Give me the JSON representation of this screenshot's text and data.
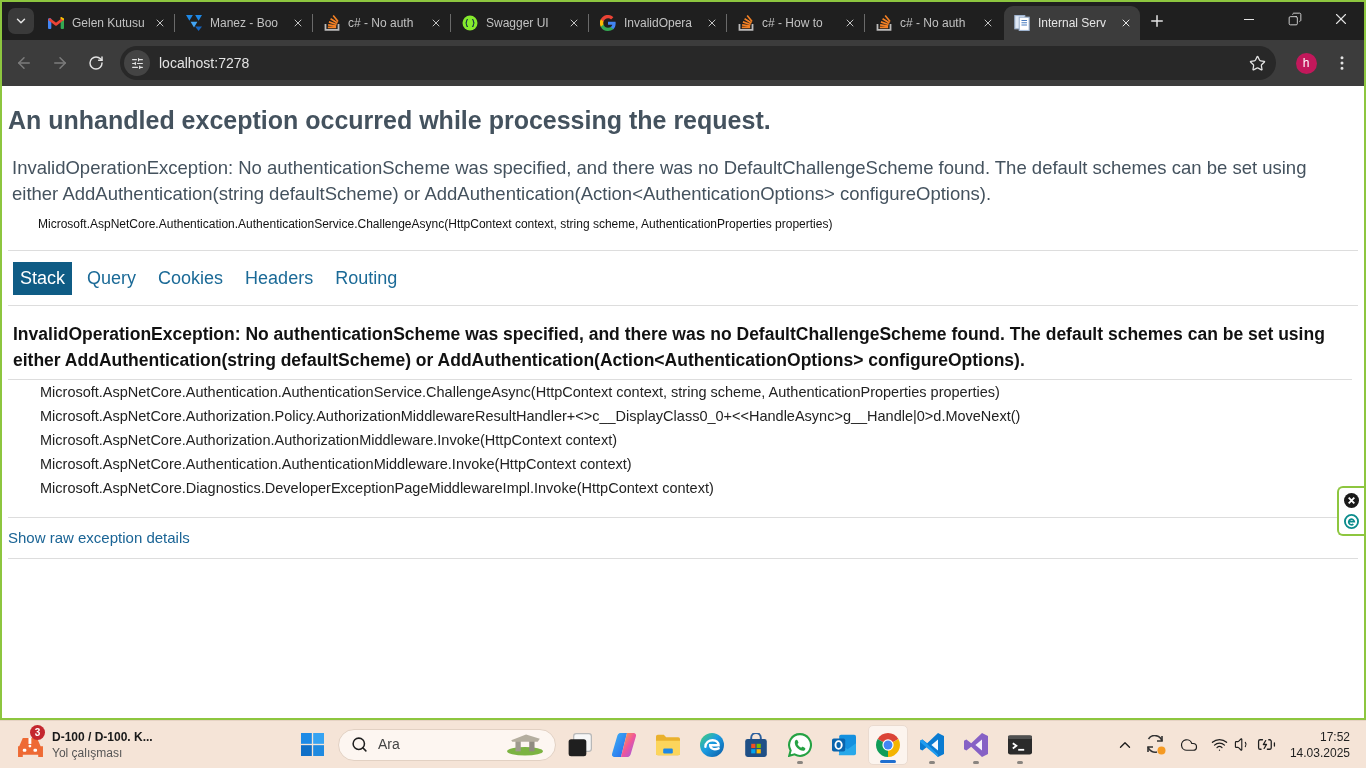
{
  "browser": {
    "tabs": [
      {
        "kind": "mail",
        "title": "Gelen Kutusu",
        "selected": false
      },
      {
        "kind": "tiles",
        "title": "Manez - Boo",
        "selected": false
      },
      {
        "kind": "stack",
        "title": "c# - No auth",
        "selected": false
      },
      {
        "kind": "braces",
        "title": "Swagger UI",
        "selected": false
      },
      {
        "kind": "google",
        "title": "InvalidOpera",
        "selected": false
      },
      {
        "kind": "stack",
        "title": "c# - How to",
        "selected": false
      },
      {
        "kind": "stack",
        "title": "c# - No auth",
        "selected": false
      },
      {
        "kind": "document",
        "title": "Internal Serv",
        "selected": true
      }
    ],
    "back": {
      "disabled": true
    },
    "forward": {
      "disabled": true
    },
    "address": "localhost:7278",
    "profile_initial": "h"
  },
  "page": {
    "heading": "An unhandled exception occurred while processing the request.",
    "error": {
      "message": "InvalidOperationException: No authenticationScheme was specified, and there was no DefaultChallengeScheme found. The default schemes can be set using either AddAuthentication(string defaultScheme) or AddAuthentication(Action<AuthenticationOptions> configureOptions).",
      "location": "Microsoft.AspNetCore.Authentication.AuthenticationService.ChallengeAsync(HttpContext context, string scheme, AuthenticationProperties properties)"
    },
    "tabs": [
      {
        "label": "Stack",
        "selected": true
      },
      {
        "label": "Query",
        "selected": false
      },
      {
        "label": "Cookies",
        "selected": false
      },
      {
        "label": "Headers",
        "selected": false
      },
      {
        "label": "Routing",
        "selected": false
      }
    ],
    "stack": {
      "title": "InvalidOperationException: No authenticationScheme was specified, and there was no DefaultChallengeScheme found. The default schemes can be set using either AddAuthentication(string defaultScheme) or AddAuthentication(Action<AuthenticationOptions> configureOptions).",
      "frames": [
        "Microsoft.AspNetCore.Authentication.AuthenticationService.ChallengeAsync(HttpContext context, string scheme, AuthenticationProperties properties)",
        "Microsoft.AspNetCore.Authorization.Policy.AuthorizationMiddlewareResultHandler+<>c__DisplayClass0_0+<<HandleAsync>g__Handle|0>d.MoveNext()",
        "Microsoft.AspNetCore.Authorization.AuthorizationMiddleware.Invoke(HttpContext context)",
        "Microsoft.AspNetCore.Authentication.AuthenticationMiddleware.Invoke(HttpContext context)",
        "Microsoft.AspNetCore.Diagnostics.DeveloperExceptionPageMiddlewareImpl.Invoke(HttpContext context)"
      ]
    },
    "raw_link": "Show raw exception details"
  },
  "taskbar": {
    "alert": {
      "badge": "3",
      "title": "D-100 / D-100. K...",
      "subtitle": "Yol çalışması"
    },
    "search": {
      "placeholder": "Ara"
    },
    "apps": [
      {
        "kind": "taskview",
        "running": false,
        "selected": false
      },
      {
        "kind": "copilot",
        "running": false,
        "selected": false
      },
      {
        "kind": "folder",
        "running": false,
        "selected": false
      },
      {
        "kind": "edge",
        "running": false,
        "selected": false
      },
      {
        "kind": "store",
        "running": false,
        "selected": false
      },
      {
        "kind": "whatsapp",
        "running": true,
        "selected": false
      },
      {
        "kind": "outlook",
        "running": false,
        "selected": false
      },
      {
        "kind": "chrome",
        "running": true,
        "selected": true
      },
      {
        "kind": "vscode",
        "running": true,
        "selected": false
      },
      {
        "kind": "studio",
        "running": true,
        "selected": false
      },
      {
        "kind": "terminal",
        "running": true,
        "selected": false
      }
    ],
    "clock": {
      "time": "17:52",
      "date": "14.03.2025"
    }
  }
}
